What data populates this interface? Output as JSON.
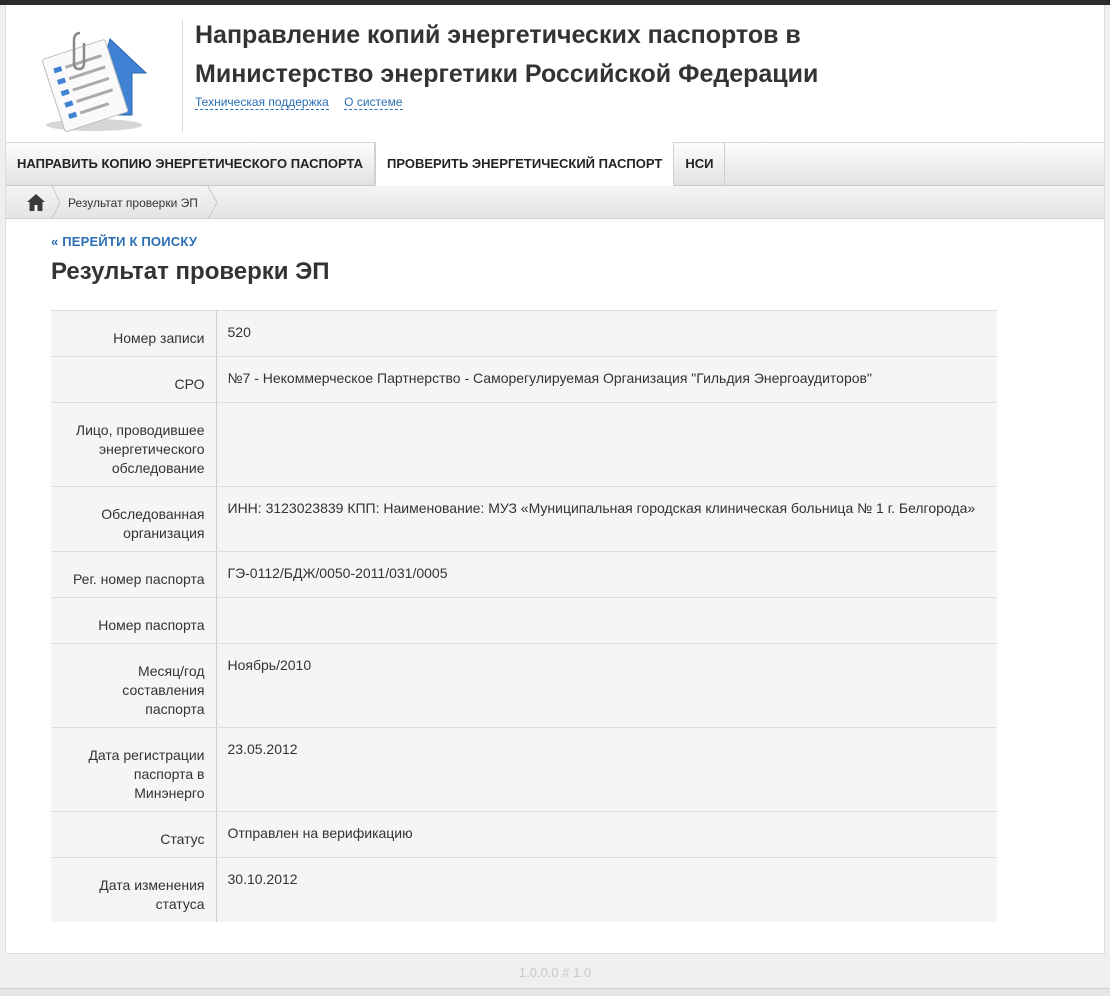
{
  "header": {
    "title_line1": "Направление копий энергетических паспортов в",
    "title_line2": "Министерство энергетики Российской Федерации",
    "links": [
      "Техническая поддержка",
      "О системе"
    ]
  },
  "nav": {
    "items": [
      {
        "label": "НАПРАВИТЬ КОПИЮ ЭНЕРГЕТИЧЕСКОГО ПАСПОРТА",
        "active": false
      },
      {
        "label": "ПРОВЕРИТЬ ЭНЕРГЕТИЧЕСКИЙ ПАСПОРТ",
        "active": true
      },
      {
        "label": "НСИ",
        "active": false
      }
    ]
  },
  "breadcrumb": {
    "home_icon": "home-icon",
    "current": "Результат проверки ЭП"
  },
  "content": {
    "back_link": "« ПЕРЕЙТИ К ПОИСКУ",
    "title": "Результат проверки ЭП",
    "rows": [
      {
        "label": "Номер записи",
        "value": "520"
      },
      {
        "label": "СРО",
        "value": "№7 - Некоммерческое Партнерство - Саморегулируемая Организация \"Гильдия Энергоаудиторов\""
      },
      {
        "label": "Лицо, проводившее энергетического обследование",
        "value": ""
      },
      {
        "label": "Обследованная организация",
        "value": "ИНН: 3123023839 КПП: Наименование: МУЗ «Муниципальная городская клиническая больница № 1 г. Белгорода»"
      },
      {
        "label": "Рег. номер паспорта",
        "value": "ГЭ-0112/БДЖ/0050-2011/031/0005"
      },
      {
        "label": "Номер паспорта",
        "value": ""
      },
      {
        "label": "Месяц/год составления паспорта",
        "value": "Ноябрь/2010"
      },
      {
        "label": "Дата регистрации паспорта в Минэнерго",
        "value": "23.05.2012"
      },
      {
        "label": "Статус",
        "value": "Отправлен на верификацию"
      },
      {
        "label": "Дата изменения статуса",
        "value": "30.10.2012"
      }
    ]
  },
  "footer": {
    "version": "1.0.0.0 # 1.0"
  },
  "colors": {
    "link": "#2a6fb5",
    "text": "#333333",
    "table_bg": "#f5f5f5"
  }
}
